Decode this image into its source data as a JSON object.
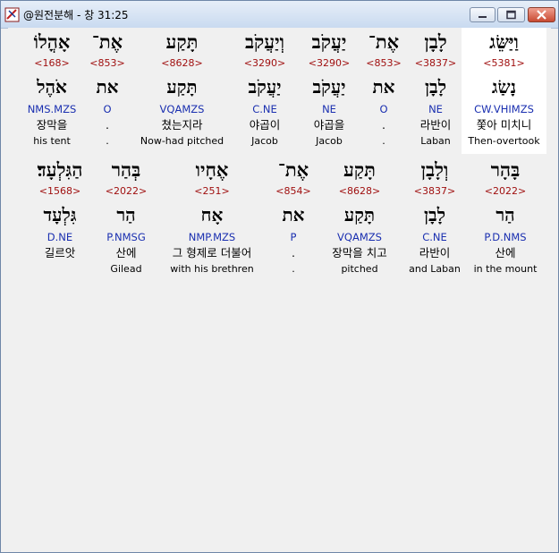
{
  "window": {
    "title": "@원전분해 - 창 31:25"
  },
  "rows": [
    [
      {
        "heb": "וַיַּשֵּׂג",
        "strong": "<5381>",
        "lemma": "נָשַׂג",
        "morph": "CW.VHIMZS",
        "kor": "쫓아 미치니",
        "eng": "Then-overtook",
        "selected": true
      },
      {
        "heb": "לָבָן",
        "strong": "<3837>",
        "lemma": "לָבָן",
        "morph": "NE",
        "kor": "라반이",
        "eng": "Laban"
      },
      {
        "heb": "אֶת־",
        "strong": "<853>",
        "lemma": "את",
        "morph": "O",
        "kor": ".",
        "eng": "."
      },
      {
        "heb": "יַעֲקֹב",
        "strong": "<3290>",
        "lemma": "יַעֲקֹב",
        "morph": "NE",
        "kor": "야곱을",
        "eng": "Jacob"
      },
      {
        "heb": "וְיַעֲקֹב",
        "strong": "<3290>",
        "lemma": "יַעֲקֹב",
        "morph": "C.NE",
        "kor": "야곱이",
        "eng": "Jacob"
      },
      {
        "heb": "תָּקַע",
        "strong": "<8628>",
        "lemma": "תָּקַע",
        "morph": "VQAMZS",
        "kor": "쳤는지라",
        "eng": "Now-had pitched"
      },
      {
        "heb": "אֶת־",
        "strong": "<853>",
        "lemma": "את",
        "morph": "O",
        "kor": ".",
        "eng": "."
      },
      {
        "heb": "אָהֳלוֹ",
        "strong": "<168>",
        "lemma": "אֹהֶל",
        "morph": "NMS.MZS",
        "kor": "장막을",
        "eng": "his tent"
      }
    ],
    [
      {
        "heb": "בָּהָר",
        "strong": "<2022>",
        "lemma": "הַר",
        "morph": "P.D.NMS",
        "kor": "산에",
        "eng": "in the mount"
      },
      {
        "heb": "וְלָבָן",
        "strong": "<3837>",
        "lemma": "לָבָן",
        "morph": "C.NE",
        "kor": "라반이",
        "eng": "and Laban"
      },
      {
        "heb": "תָּקַע",
        "strong": "<8628>",
        "lemma": "תָּקַע",
        "morph": "VQAMZS",
        "kor": "장막을 치고",
        "eng": "pitched"
      },
      {
        "heb": "אֶת־",
        "strong": "<854>",
        "lemma": "את",
        "morph": "P",
        "kor": ".",
        "eng": "."
      },
      {
        "heb": "אֶחָיו",
        "strong": "<251>",
        "lemma": "אָח",
        "morph": "NMP.MZS",
        "kor": "그 형제로 더불어",
        "eng": "with his brethren"
      },
      {
        "heb": "בְּהַר",
        "strong": "<2022>",
        "lemma": "הַר",
        "morph": "P.NMSG",
        "kor": "산에",
        "eng": "Gilead"
      },
      {
        "heb": "הַגִּלְעָד׃",
        "strong": "<1568>",
        "lemma": "גִּלְעָד",
        "morph": "D.NE",
        "kor": "길르앗",
        "eng": ""
      }
    ]
  ]
}
